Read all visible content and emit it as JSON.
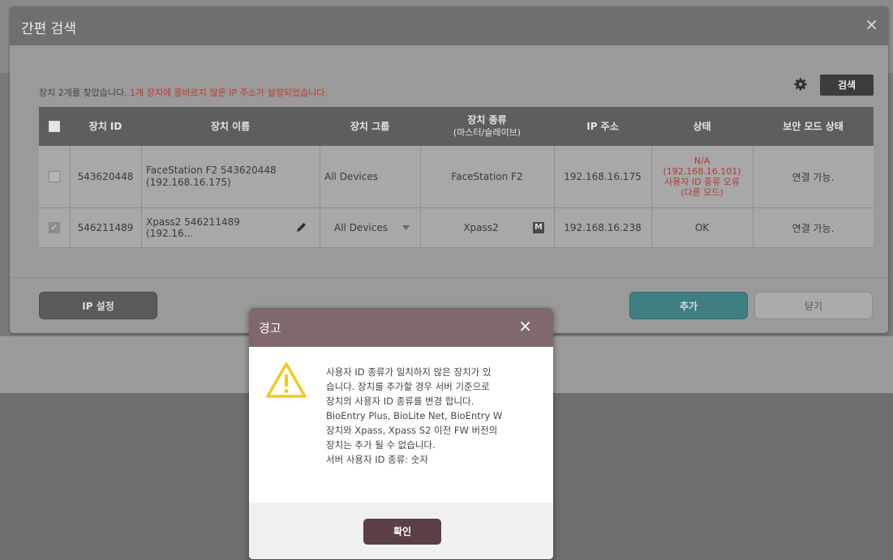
{
  "dialog": {
    "title": "간편 검색",
    "close": "×",
    "message_normal": "장치 2개를 찾았습니다. ",
    "message_warning": "1개 장치에 올바르지 않은 IP 주소가 설정되었습니다.",
    "search_label": "검색"
  },
  "table": {
    "headers": {
      "device_id": "장치 ID",
      "device_name": "장치 이름",
      "device_group": "장치 그룹",
      "device_type": "장치 종류",
      "device_type_sub": "(마스터/슬레이브)",
      "ip": "IP 주소",
      "status": "상태",
      "security": "보안 모드 상태"
    },
    "rows": [
      {
        "checked": false,
        "id": "543620448",
        "name": "FaceStation F2 543620448 (192.168.16.175)",
        "group": "All Devices",
        "type": "FaceStation F2",
        "ip": "192.168.16.175",
        "status": "N/A\n(192.168.16.101)\n사용자 ID 종류 오류\n(다른 모드)",
        "security": "연결 가능."
      },
      {
        "checked": true,
        "id": "546211489",
        "name": "Xpass2 546211489 (192.16...",
        "group": "All Devices",
        "type": "Xpass2",
        "type_badge": "M",
        "ip": "192.168.16.238",
        "status": "OK",
        "security": "연결 가능."
      }
    ]
  },
  "buttons": {
    "ip_settings": "IP 설정",
    "add": "추가",
    "close": "닫기"
  },
  "alert": {
    "title": "경고",
    "close": "×",
    "text": "사용자 ID 종류가 일치하지 않은 장치가 있\n습니다. 장치를 추가할 경우 서버 기준으로\n장치의 사용자 ID 종류를 변경 합니다.\nBioEntry Plus, BioLite Net, BioEntry W\n장치와 Xpass, Xpass S2 이전 FW 버전의\n장치는 추가 될 수 없습니다.\n서버 사용자 ID 종류: 숫자",
    "ok": "확인"
  },
  "colors": {
    "alert_header": "#80696a",
    "ok_button": "#5b3f45",
    "add_button": "#3f7f82",
    "warning_text": "#c0392b",
    "warning_icon": "#f2c81b"
  },
  "icons": [
    "gear-icon",
    "pencil-icon",
    "dropdown-arrow-icon",
    "warning-icon",
    "close-icon",
    "checkmark-icon"
  ]
}
